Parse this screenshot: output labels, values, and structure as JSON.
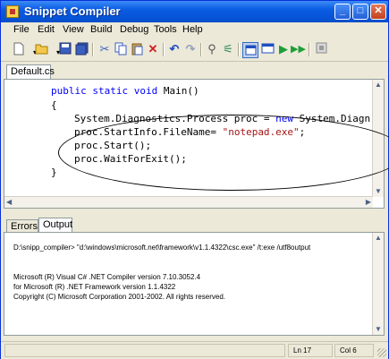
{
  "window": {
    "title": "Snippet Compiler"
  },
  "titlebar_buttons": {
    "minimize": "_",
    "maximize": "□",
    "close": "✕"
  },
  "menu": [
    "File",
    "Edit",
    "View",
    "Build",
    "Debug",
    "Tools",
    "Help"
  ],
  "toolbar": {
    "icons": [
      "new-icon",
      "open-icon",
      "save-icon",
      "save-all-icon",
      "cut-icon",
      "copy-icon",
      "paste-icon",
      "delete-icon",
      "undo-icon",
      "redo-icon",
      "find-icon",
      "replace-icon",
      "window-icon",
      "build-icon",
      "run-icon",
      "run-all-icon",
      "stop-icon"
    ]
  },
  "editor": {
    "tab": "Default.cs",
    "lines": {
      "l1_kw": "public static void",
      "l1_rest": " Main()",
      "l2": "{",
      "l3_a": "System.Diagnostics.Process proc = ",
      "l3_kw": "new",
      "l3_b": " System.Diagn",
      "l4_a": "proc.StartInfo.FileName= ",
      "l4_str": "\"notepad.exe\"",
      "l4_b": ";",
      "l5": "proc.Start();",
      "l6": "proc.WaitForExit();",
      "l7": "}"
    }
  },
  "bottom_tabs": {
    "errors": "Errors",
    "output": "Output"
  },
  "output": {
    "lines": [
      "D:\\snipp_compiler> \"d:\\windows\\microsoft.net\\framework\\v1.1.4322\\csc.exe\" /t:exe /utf8output",
      "Microsoft (R) Visual C# .NET Compiler version 7.10.3052.4",
      "for Microsoft (R) .NET Framework version 1.1.4322",
      "Copyright (C) Microsoft Corporation 2001-2002. All rights reserved."
    ]
  },
  "status": {
    "line": "Ln 17",
    "col": "Col 6"
  },
  "colors": {
    "keyword": "#0000ff",
    "string": "#a31515",
    "titlebar": "#0a5ce4"
  }
}
